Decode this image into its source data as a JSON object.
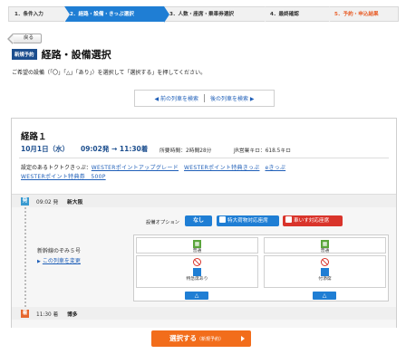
{
  "steps": [
    {
      "label": "1．条件入力"
    },
    {
      "label": "2．経路・設備・きっぷ選択"
    },
    {
      "label": "3．人数・座席・乗車券選択"
    },
    {
      "label": "4．最終確認"
    },
    {
      "label": "5．予約・申込結果"
    }
  ],
  "back_label": "戻る",
  "badge": "新規予約",
  "page_title": "経路・設備選択",
  "instruction": "ご希望の設備（「〇」「△」「あり」）を選択して「選択する」を押してください。",
  "search": {
    "prev": "◀ 前の列車を検索",
    "next": "後の列車を検索 ▶"
  },
  "route": {
    "title": "経路１",
    "date": "10月1日（水）",
    "time": "09:02発 → 11:30着",
    "duration": "所要時間：2時間28分",
    "distance": "JR営業キロ：618.5キロ",
    "deals_prefix": "設定のあるトクトクきっぷ：",
    "deals": [
      "WESTERポイントアップグレード",
      "WESTERポイント特典きっぷ",
      "eきっぷ",
      "WESTERポイント特典券　500P"
    ]
  },
  "departure": {
    "icon": "発",
    "time": "09:02 発",
    "station": "新大阪"
  },
  "arrival": {
    "icon": "着",
    "time": "11:30 着",
    "station": "博多"
  },
  "train": {
    "name": "新幹線のぞみ５号",
    "change": "この列車を変更"
  },
  "equipment": {
    "label": "設備オプション",
    "none": "なし",
    "luggage": "特大荷物対応座席",
    "wheelchair": "車いす対応座席"
  },
  "seats": {
    "left_top": "普通",
    "right_top": "普通",
    "left_bottom": "特急席あり",
    "right_bottom": "付添席",
    "select_symbol": "△"
  },
  "submit": {
    "label": "選択する",
    "sub": "（新規予約）"
  }
}
